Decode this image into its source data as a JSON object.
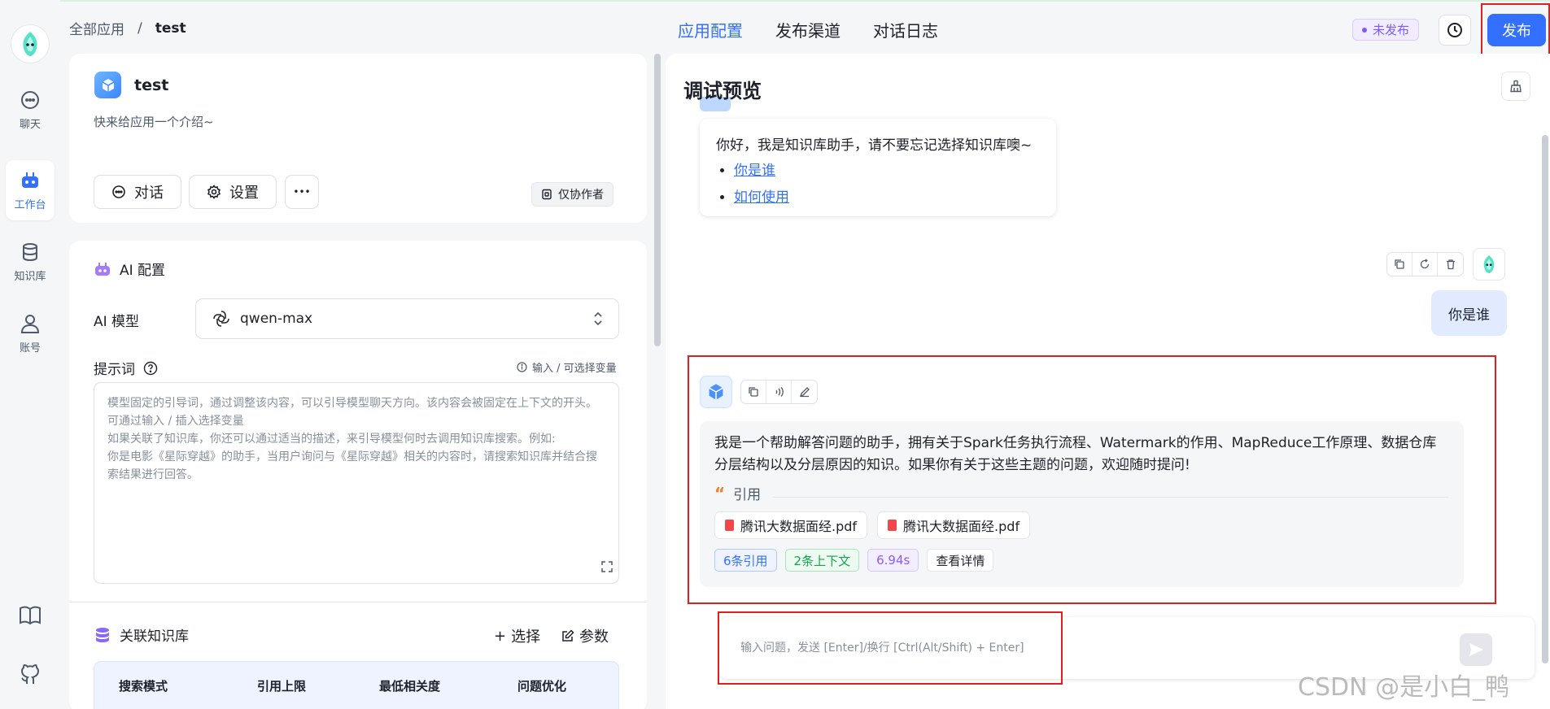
{
  "nav": {
    "items": [
      {
        "label": "聊天",
        "icon": "chat-bubble-icon"
      },
      {
        "label": "工作台",
        "icon": "robot-icon"
      },
      {
        "label": "知识库",
        "icon": "database-icon"
      },
      {
        "label": "账号",
        "icon": "user-icon"
      }
    ]
  },
  "header": {
    "breadcrumb_root": "全部应用",
    "breadcrumb_sep": "/",
    "breadcrumb_current": "test",
    "tabs": [
      "应用配置",
      "发布渠道",
      "对话日志"
    ],
    "status": "未发布",
    "publish_label": "发布"
  },
  "app": {
    "name": "test",
    "intro": "快来给应用一个介绍~",
    "chat_label": "对话",
    "settings_label": "设置",
    "more_label": "•••",
    "collab_label": "仅协作者"
  },
  "ai_config": {
    "title": "AI 配置",
    "model_label": "AI 模型",
    "model_value": "qwen-max",
    "prompt_label": "提示词",
    "prompt_hint": "输入 / 可选择变量",
    "prompt_placeholder": "模型固定的引导词，通过调整该内容，可以引导模型聊天方向。该内容会被固定在上下文的开头。可通过输入 / 插入选择变量\n如果关联了知识库，你还可以通过适当的描述，来引导模型何时去调用知识库搜索。例如:\n你是电影《星际穿越》的助手，当用户询问与《星际穿越》相关的内容时，请搜索知识库并结合搜索结果进行回答。"
  },
  "knowledge": {
    "title": "关联知识库",
    "select_label": "选择",
    "params_label": "参数",
    "columns": [
      "搜索模式",
      "引用上限",
      "最低相关度",
      "问题优化"
    ]
  },
  "preview": {
    "title": "调试预览",
    "welcome_text": "你好，我是知识库助手，请不要忘记选择知识库噢~",
    "welcome_links": [
      "你是谁",
      "如何使用"
    ],
    "user_message": "你是谁",
    "answer": "我是一个帮助解答问题的助手，拥有关于Spark任务执行流程、Watermark的作用、MapReduce工作原理、数据仓库分层结构以及分层原因的知识。如果你有关于这些主题的问题，欢迎随时提问!",
    "quote_label": "引用",
    "files": [
      "腾讯大数据面经.pdf",
      "腾讯大数据面经.pdf"
    ],
    "tags": [
      "6条引用",
      "2条上下文",
      "6.94s",
      "查看详情"
    ],
    "input_placeholder": "输入问题，发送 [Enter]/换行 [Ctrl(Alt/Shift) + Enter]"
  },
  "watermark": "CSDN @是小白_鸭",
  "colors": {
    "accent": "#3370ff",
    "highlight_box": "#e02020"
  }
}
